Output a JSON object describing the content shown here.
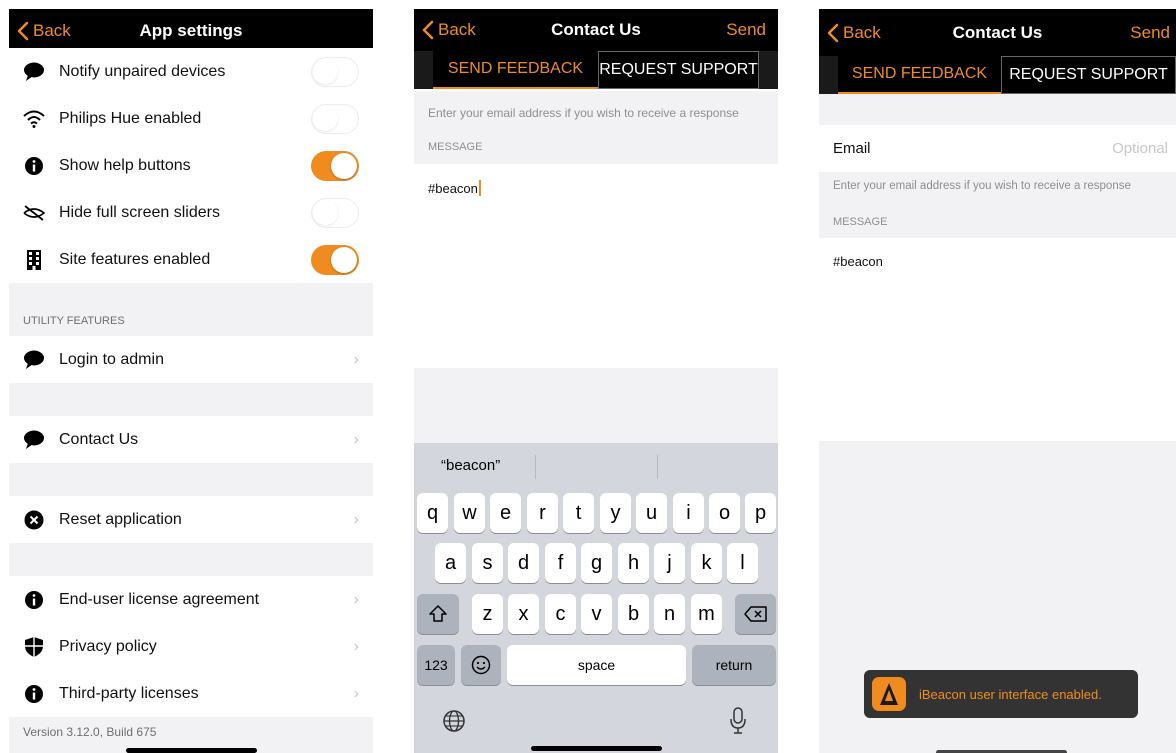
{
  "colors": {
    "accent": "#f08c1f",
    "navbar": "#000000",
    "group_bg": "#f2f2f4",
    "keyboard_bg": "#d3d6dc"
  },
  "settings": {
    "back_label": "Back",
    "title": "App settings",
    "rows": [
      {
        "label": "Notify unpaired devices",
        "icon": "speech-bubble-icon",
        "toggle": false
      },
      {
        "label": "Philips Hue enabled",
        "icon": "wifi-icon",
        "toggle": false
      },
      {
        "label": "Show help buttons",
        "icon": "info-icon",
        "toggle": true
      },
      {
        "label": "Hide full screen sliders",
        "icon": "eye-off-icon",
        "toggle": false
      },
      {
        "label": "Site features enabled",
        "icon": "building-icon",
        "toggle": true
      }
    ],
    "utility_header": "UTILITY FEATURES",
    "utility_rows": [
      {
        "label": "Login to admin",
        "icon": "speech-bubble-icon"
      },
      {
        "label": "Contact Us",
        "icon": "speech-bubble-icon"
      },
      {
        "label": "Reset application",
        "icon": "x-circle-icon"
      },
      {
        "label": "End-user license agreement",
        "icon": "info-icon"
      },
      {
        "label": "Privacy policy",
        "icon": "shield-icon"
      },
      {
        "label": "Third-party licenses",
        "icon": "info-icon"
      }
    ],
    "version": "Version 3.12.0, Build 675"
  },
  "contact": {
    "back_label": "Back",
    "title": "Contact Us",
    "send_label": "Send",
    "tabs": [
      "SEND FEEDBACK",
      "REQUEST SUPPORT"
    ],
    "email_hint": "Enter your email address if you wish to receive a response",
    "message_header": "MESSAGE",
    "message_text": "#beacon",
    "email_label": "Email",
    "email_placeholder": "Optional"
  },
  "keyboard": {
    "suggestion": "“beacon”",
    "row1": [
      "q",
      "w",
      "e",
      "r",
      "t",
      "y",
      "u",
      "i",
      "o",
      "p"
    ],
    "row2": [
      "a",
      "s",
      "d",
      "f",
      "g",
      "h",
      "j",
      "k",
      "l"
    ],
    "row3": [
      "z",
      "x",
      "c",
      "v",
      "b",
      "n",
      "m"
    ],
    "num_label": "123",
    "space_label": "space",
    "return_label": "return"
  },
  "toast": {
    "text": "iBeacon user interface enabled."
  }
}
